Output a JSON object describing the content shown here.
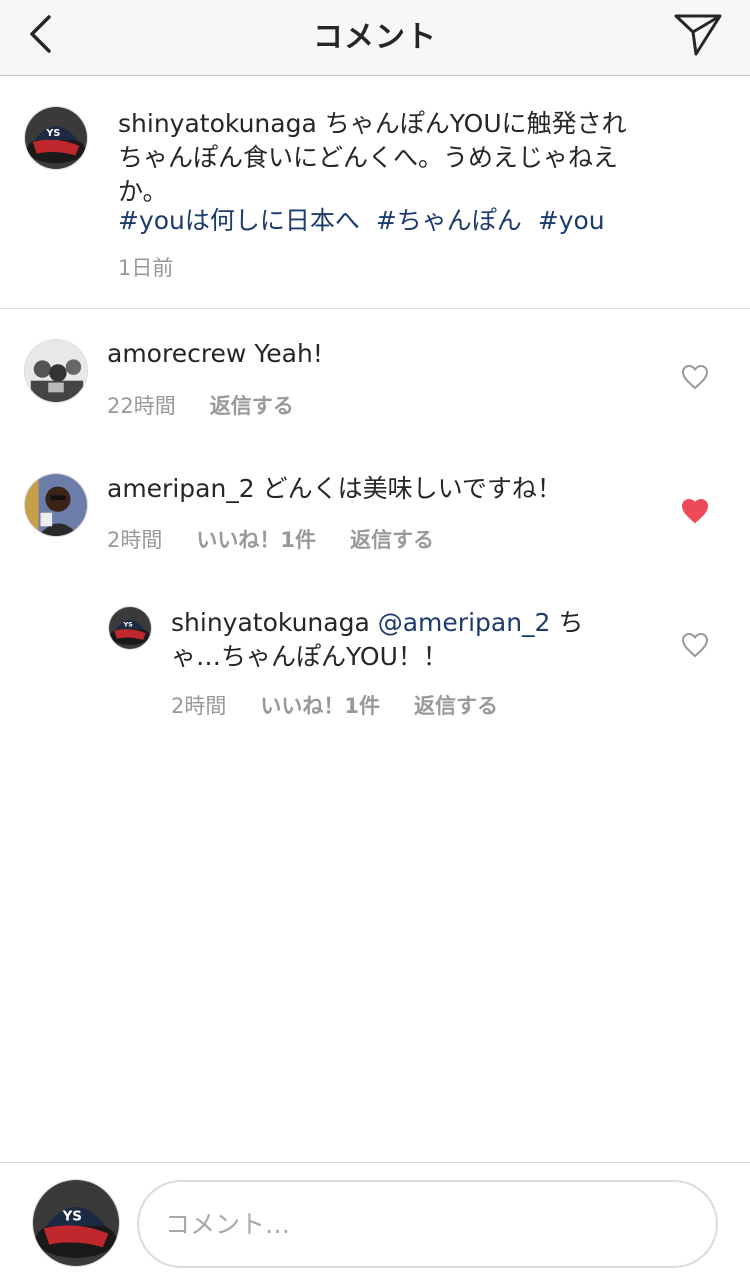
{
  "header": {
    "title": "コメント",
    "back_icon": "chevron-left-icon",
    "share_icon": "paper-plane-icon"
  },
  "caption": {
    "username": "shinyatokunaga",
    "text": "ちゃんぽんYOUに触発されちゃんぽん食いにどんくへ。うめえじゃねえか。",
    "hashtags": [
      "#youは何しに日本へ",
      "#ちゃんぽん",
      "#you"
    ],
    "time": "1日前"
  },
  "comments": [
    {
      "username": "amorecrew",
      "text": "Yeah!",
      "time": "22時間",
      "likes": "",
      "reply_label": "返信する",
      "liked": false
    },
    {
      "username": "ameripan_2",
      "text": "どんくは美味しいですね！",
      "time": "2時間",
      "likes": "いいね！1件",
      "reply_label": "返信する",
      "liked": true
    },
    {
      "username": "shinyatokunaga",
      "mention": "@ameripan_2",
      "text": "ちゃ…ちゃんぽんYOU！！",
      "time": "2時間",
      "likes": "いいね！1件",
      "reply_label": "返信する",
      "liked": false
    }
  ],
  "composer": {
    "placeholder": "コメント…"
  },
  "colors": {
    "link": "#1e3b6e",
    "meta": "#999999",
    "heart_liked": "#ed4956",
    "heart_outline": "#999999"
  }
}
